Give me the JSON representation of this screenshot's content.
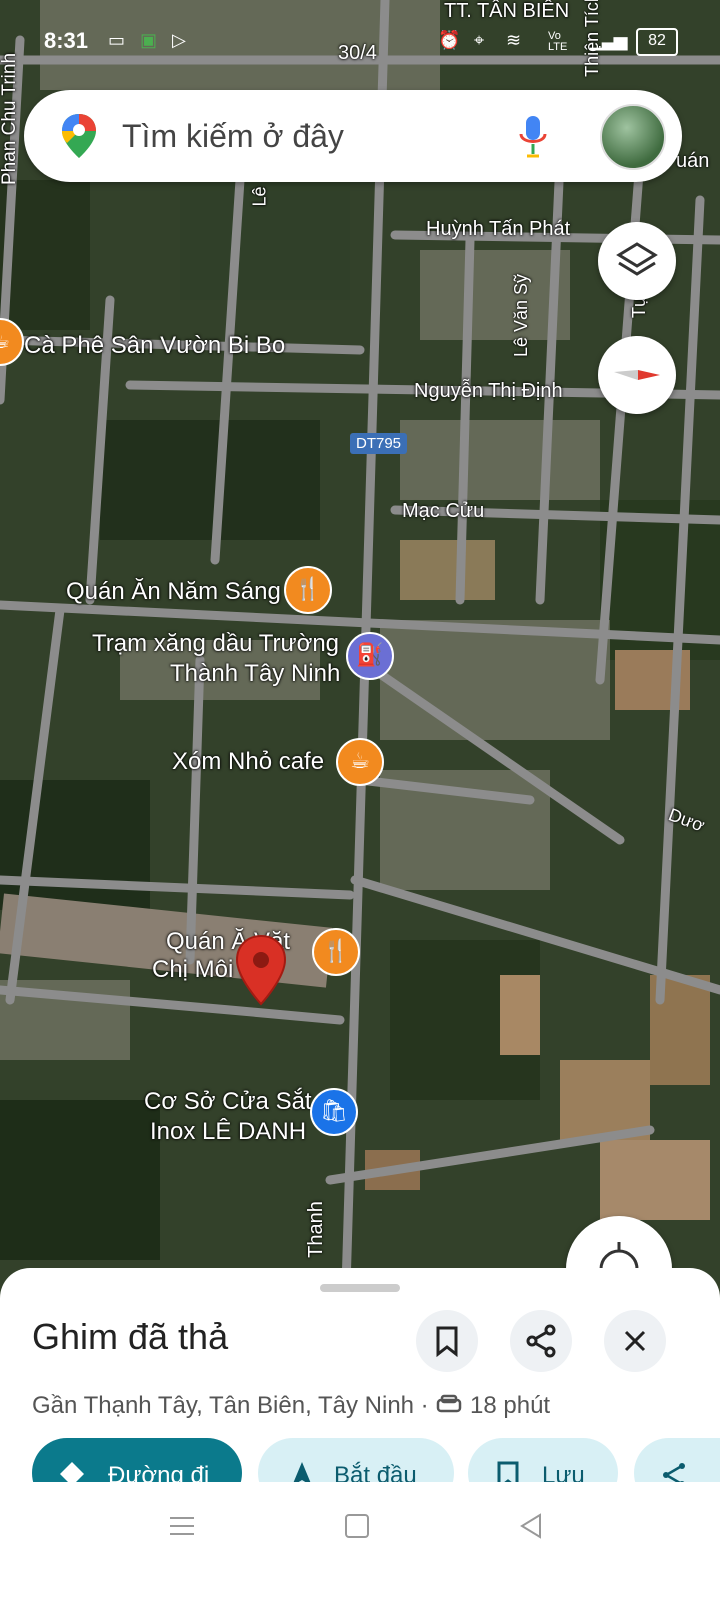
{
  "status_bar": {
    "time": "8:31",
    "battery": "82",
    "net": "Vo\nLTE"
  },
  "search": {
    "placeholder": "Tìm kiếm ở đây"
  },
  "map_labels": {
    "top_town": "TT. TÂN BIÊN",
    "road_30_4": "30/4",
    "phan_chu_trinh": "Phan Chu Trinh",
    "le_1": "Lê",
    "huynh_tan_phat": "Huỳnh Tấn Phát",
    "le_van_sy": "Lê Văn Sỹ",
    "ca_phe": "Cà Phê Sân Vườn Bi Bo",
    "nguyen_thi_dinh": "Nguyễn Thị Định",
    "dt795": "DT795",
    "mac_cuu": "Mạc Cửu",
    "quan_an_nam_sang": "Quán Ăn Năm Sáng",
    "tram_xang_1": "Trạm xăng dầu Trường",
    "tram_xang_2": "Thành Tây Ninh",
    "xom_nho": "Xóm Nhỏ cafe",
    "quan_an_vat_1": "Quán Ă   Vặt",
    "quan_an_vat_2": "Chị Môi    m",
    "co_so_1": "Cơ Sở Cửa Sắt",
    "co_so_2": "Inox LÊ DANH",
    "thanh": "Thanh",
    "right_1": "uán",
    "right_2": "Dươ",
    "thien_tich": "Thiện Tích",
    "tu": "Tự"
  },
  "sheet": {
    "title": "Ghim đã thả",
    "subtitle": "Gần Thạnh Tây, Tân Biên, Tây Ninh · ",
    "drive_time": "18 phút",
    "actions": [
      {
        "label": "Đường đi"
      },
      {
        "label": "Bắt đầu"
      },
      {
        "label": "Lưu"
      }
    ]
  },
  "colors": {
    "accent": "#0b7a8c",
    "pin": "#d93025",
    "poi_food": "#f28a1f",
    "poi_gas": "#6b6fd4",
    "poi_shop": "#1a73e8"
  }
}
